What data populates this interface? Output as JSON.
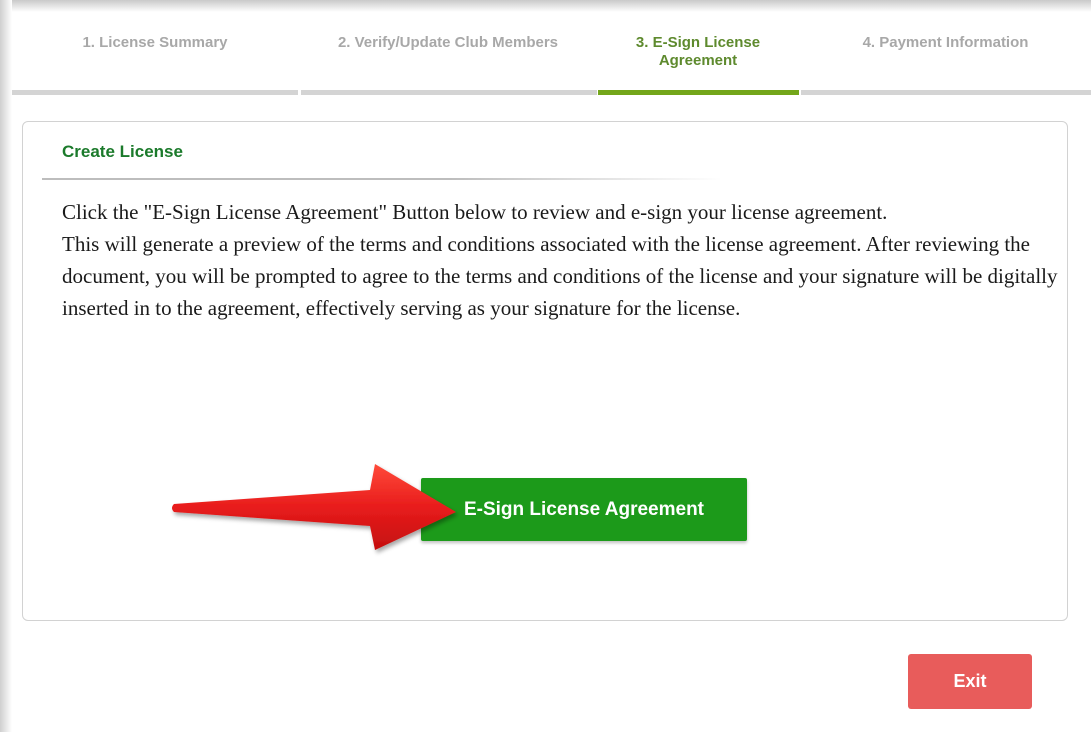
{
  "steps": [
    {
      "label": "1. License Summary",
      "active": false
    },
    {
      "label": "2. Verify/Update Club Members",
      "active": false
    },
    {
      "label_line1": "3. E-Sign License",
      "label_line2": "Agreement",
      "active": true
    },
    {
      "label": "4. Payment Information",
      "active": false
    }
  ],
  "panel": {
    "title": "Create License",
    "paragraphs": [
      "Click the \"E-Sign License Agreement\" Button below to review and e-sign your license agreement.",
      "This will generate a preview of the terms and conditions associated with the license agreement. After reviewing the document, you will be prompted to agree to the terms and conditions of the license and your signature will be digitally inserted in to the agreement, effectively serving as your signature for the license."
    ],
    "esign_button_label": "E-Sign License Agreement"
  },
  "exit_button_label": "Exit",
  "colors": {
    "active_step": "#5e8a2e",
    "active_bar": "#73a61a",
    "title_green": "#1b7a2b",
    "esign_button": "#1c9a1a",
    "exit_button": "#e85c5b",
    "arrow": "#e81c1c"
  },
  "annotation": {
    "arrow_icon": "red-arrow-icon"
  }
}
